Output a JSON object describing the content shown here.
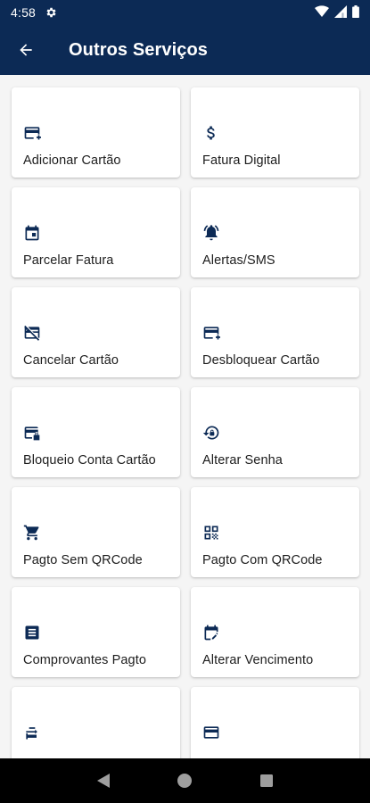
{
  "status_bar": {
    "time": "4:58",
    "icons": [
      "gear-icon",
      "wifi-icon",
      "signal-icon",
      "battery-icon"
    ]
  },
  "app_bar": {
    "title": "Outros Serviços",
    "back_icon": "arrow-back-icon"
  },
  "colors": {
    "primary": "#0c2a55",
    "background": "#f5f5f5",
    "card": "#ffffff",
    "nav_bar": "#000000"
  },
  "services": [
    {
      "label": "Adicionar Cartão",
      "icon": "credit-card-add-icon"
    },
    {
      "label": "Fatura Digital",
      "icon": "dollar-icon"
    },
    {
      "label": "Parcelar Fatura",
      "icon": "calendar-icon"
    },
    {
      "label": "Alertas/SMS",
      "icon": "bell-ringing-icon"
    },
    {
      "label": "Cancelar Cartão",
      "icon": "credit-card-off-icon"
    },
    {
      "label": "Desbloquear Cartão",
      "icon": "credit-card-add-icon"
    },
    {
      "label": "Bloqueio Conta Cartão",
      "icon": "credit-card-lock-icon"
    },
    {
      "label": "Alterar Senha",
      "icon": "lock-reset-icon"
    },
    {
      "label": "Pagto Sem QRCode",
      "icon": "cart-icon"
    },
    {
      "label": "Pagto Com QRCode",
      "icon": "qrcode-icon"
    },
    {
      "label": "Comprovantes Pagto",
      "icon": "receipt-icon"
    },
    {
      "label": "Alterar Vencimento",
      "icon": "calendar-edit-icon"
    },
    {
      "label": "",
      "icon": "transfer-icon"
    },
    {
      "label": "",
      "icon": "credit-card-icon"
    }
  ],
  "nav_bar": {
    "buttons": [
      "back-triangle-icon",
      "home-circle-icon",
      "recents-square-icon"
    ]
  }
}
